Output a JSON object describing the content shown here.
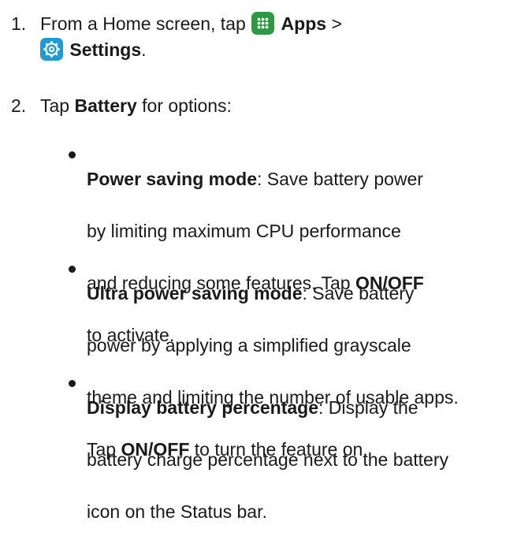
{
  "steps": [
    {
      "number": "1.",
      "text_before": "From a Home screen, tap",
      "apps_label": "Apps",
      "separator": ">",
      "settings_label": "Settings",
      "end": "."
    },
    {
      "number": "2.",
      "text_before": "Tap",
      "bold": "Battery",
      "text_after": "for options:"
    }
  ],
  "bullets": [
    {
      "title": "Power saving mode",
      "line1": ": Save battery power",
      "line2": "by limiting maximum CPU performance",
      "line3a": "and reducing some features. Tap",
      "line3b": "ON/OFF",
      "line4": "to activate."
    },
    {
      "title": "Ultra power saving mode",
      "line1": ": Save battery",
      "line2": "power by applying a simplified grayscale",
      "line3": "theme and limiting the number of usable apps.",
      "line4a": "Tap",
      "line4b": "ON/OFF",
      "line4c": "to turn the feature on."
    },
    {
      "title": "Display battery percentage",
      "line1": ": Display the",
      "line2": "battery charge percentage next to the battery",
      "line3": "icon on the Status bar."
    }
  ],
  "icons": {
    "apps": "apps-grid-icon",
    "settings": "settings-gear-icon"
  },
  "colors": {
    "apps_icon_bg": "#2a9b43",
    "settings_icon_bg": "#1e9ad6",
    "text": "#1a1a1a"
  }
}
